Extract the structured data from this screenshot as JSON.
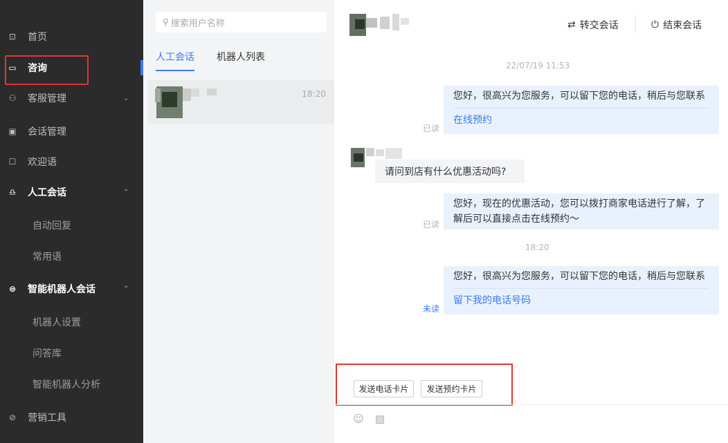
{
  "sidebar": {
    "items": [
      {
        "label": "首页",
        "icon": "home-icon",
        "glyph": "⊡"
      },
      {
        "label": "咨询",
        "icon": "chat-icon",
        "glyph": "▭"
      },
      {
        "label": "客服管理",
        "icon": "user-group-icon",
        "glyph": "⚇",
        "chevron": "⌄"
      },
      {
        "label": "会话管理",
        "icon": "clipboard-icon",
        "glyph": "▣"
      },
      {
        "label": "欢迎语",
        "icon": "greeting-icon",
        "glyph": "☐"
      },
      {
        "label": "人工会话",
        "icon": "headset-icon",
        "glyph": "♎",
        "chevron": "⌃"
      },
      {
        "label": "智能机器人会话",
        "icon": "robot-icon",
        "glyph": "⊜",
        "chevron": "⌃"
      },
      {
        "label": "营销工具",
        "icon": "marketing-icon",
        "glyph": "⊘"
      }
    ],
    "sub_manual": [
      "自动回复",
      "常用语"
    ],
    "sub_robot": [
      "机器人设置",
      "问答库",
      "智能机器人分析"
    ]
  },
  "list": {
    "search_placeholder": "搜索用户名称",
    "search_icon": "search-icon",
    "tabs": [
      "人工会话",
      "机器人列表"
    ],
    "conversation": {
      "time": "18:20"
    }
  },
  "chat": {
    "transfer_label": "转交会话",
    "transfer_glyph": "⇄",
    "end_label": "结束会话",
    "end_glyph": "⏻",
    "timestamp1": "22/07/19 11:53",
    "msg1_text": "您好，很高兴为您服务，可以留下您的电话，稍后与您联系",
    "msg1_link": "在线预约",
    "msg1_status": "已读",
    "incoming_text": "请问到店有什么优惠活动吗?",
    "msg2_text": "您好，现在的优惠活动，您可以拨打商家电话进行了解，了解后可以直接点击在线预约～",
    "msg2_status": "已读",
    "timestamp2": "18:20",
    "msg3_text": "您好，很高兴为您服务，可以留下您的电话，稍后与您联系",
    "msg3_link": "留下我的电话号码",
    "msg3_status": "未读",
    "card_buttons": [
      "发送电话卡片",
      "发送预约卡片"
    ],
    "emoji_glyph": "☺",
    "image_glyph": "▨"
  },
  "colors": {
    "accent": "#3d7bf5",
    "highlight": "#e0382c",
    "sidebar": "#2b2b2b"
  }
}
